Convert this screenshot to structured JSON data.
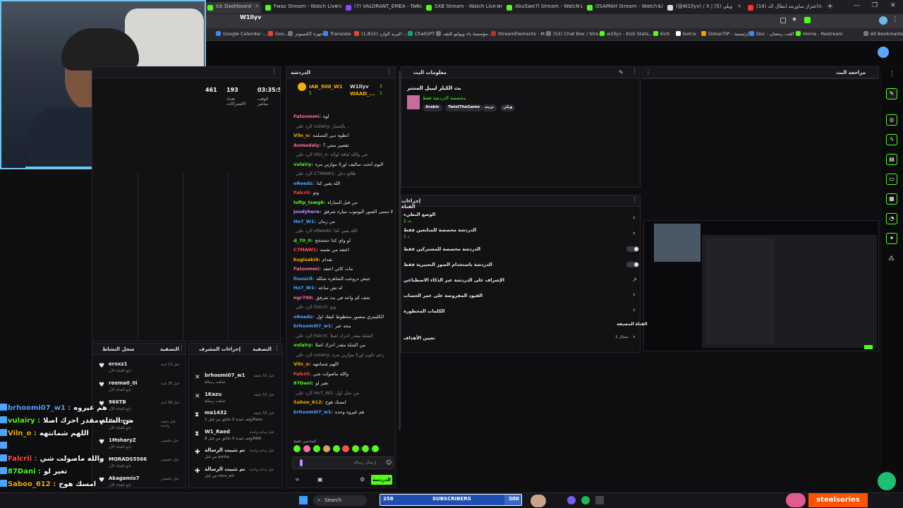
{
  "browser": {
    "tabs": [
      {
        "label": "ick Dashboard"
      },
      {
        "label": "Fwaz Stream - Watch Live on"
      },
      {
        "label": "(7) VALORANT_EMEA - Twitch"
      },
      {
        "label": "SXB Stream - Watch Live on"
      },
      {
        "label": "AbuSwe7l Stream - Watch Live"
      },
      {
        "label": "OSAMAH Stream - Watch Live"
      },
      {
        "label": "(@W1llyv) / X | (5) ويلي"
      },
      {
        "label": "(14) اعتزاز ساورمه ابطال الد..."
      }
    ],
    "bookmarks": [
      "Google Calendar -...",
      "Goo...",
      "أجهزة الكمبيوتر",
      "Translate",
      "(1,815) البريد الوارد -...",
      "ChatGPT",
      "مؤسسة باء ويوليو للتقنـ...",
      "StreamElements - M...",
      "(52) Chat Box / Stre...",
      "w1llyv - Kick Stats,...",
      "Kick",
      "botrix",
      "DokanTIP - الرئيسية",
      "Doc - العب رمضان",
      "Home - Restream",
      "All Bookmarks"
    ],
    "channel_name": "W1llyv"
  },
  "stats": {
    "time": "03:35:50",
    "time_label": "الوقت مباشر",
    "subs": "193",
    "subs_label": "تعداد الاشتراكات",
    "followers": "461"
  },
  "chat_panel": {
    "title": "الدردشة",
    "pinned": [
      {
        "user": "IAB_900_W1",
        "count": "5"
      },
      {
        "user": "W1llyv",
        "count": "3"
      },
      {
        "user": "WAAD_...",
        "count": "1"
      }
    ],
    "messages": [
      {
        "user": "Fatoommi:",
        "text": "لوه",
        "color": "#ff6b9d"
      },
      {
        "user": "",
        "text": "الرد على vulairy: يالحمار ..",
        "color": "#888"
      },
      {
        "user": "Viln_o:",
        "text": "انطوه ديي التسلمه",
        "color": "#f0b000"
      },
      {
        "user": "Anmedaly:",
        "text": "تقصير منتي ؟",
        "color": "#ff6b9d"
      },
      {
        "user": "",
        "text": "الرد على Viln_o: جي والله لياقة لولاه",
        "color": "#888"
      },
      {
        "user": "vulairy:",
        "text": "اليوم أتحت ساليف اورلا موازين مره",
        "color": "#53fc18"
      },
      {
        "user": "",
        "text": "الرد على C7MAW1: طالع دخل",
        "color": "#888"
      },
      {
        "user": "oReedz:",
        "text": "الله يعين كذا",
        "color": "#4fa3ff"
      },
      {
        "user": "Falcrii:",
        "text": "وتو",
        "color": "#ff4d4d"
      },
      {
        "user": "loftp_tswg6:",
        "text": "من قبل المباراة",
        "color": "#53fc18"
      },
      {
        "user": "joodyhere:",
        "text": "ويلي لا تنسى الصور اليوتيوب مياره شرفق",
        "color": "#c18cff"
      },
      {
        "user": "Ho7_W1:",
        "text": "من زمان",
        "color": "#4fa3ff"
      },
      {
        "user": "",
        "text": "الرد على oReedz: الله يعين كذا",
        "color": "#888"
      },
      {
        "user": "d_70_0:",
        "text": "لو واي كذا خخخخخ",
        "color": "#53fc18"
      },
      {
        "user": "C7MAW1:",
        "text": "اعتقد من نفسه",
        "color": "#ff4d4d"
      },
      {
        "user": "kugisaki4:",
        "text": "تقدام",
        "color": "#f0b000"
      },
      {
        "user": "Fatoommi:",
        "text": "مات كائي اعتقد",
        "color": "#ff6b9d"
      },
      {
        "user": "lluuucll:",
        "text": "جيش دروجب الشاهره شكله",
        "color": "#4fa3ff"
      },
      {
        "user": "Ho7_W1:",
        "text": "له نص ساعه",
        "color": "#4fa3ff"
      },
      {
        "user": "ngr700:",
        "text": "شف كم واحد في بث شرفق",
        "color": "#ff6b9d"
      },
      {
        "user": "",
        "text": "الرد على Falcrii: وتو",
        "color": "#888"
      },
      {
        "user": "oReedz:",
        "text": "الكلبيتري منصور محظوط كيفك اول",
        "color": "#4fa3ff"
      },
      {
        "user": "brhoomi07_w1:",
        "text": "محد عبر",
        "color": "#4fa3ff"
      },
      {
        "user": "",
        "text": "الرد على Falcrii: الشلة مقدر احرك اصلا",
        "color": "#888"
      },
      {
        "user": "vulairy:",
        "text": "من الشلة مقدر احرك اصلا",
        "color": "#53fc18"
      },
      {
        "user": "",
        "text": "الرد على vulairy: زعم تكون اورلا موازين مره",
        "color": "#888"
      },
      {
        "user": "Viln_o:",
        "text": "اللهم شماتتهه",
        "color": "#f0b000"
      },
      {
        "user": "Falcrii:",
        "text": "والله ماصولت شي",
        "color": "#ff4d4d"
      },
      {
        "user": "87Dani:",
        "text": "تغير لو",
        "color": "#53fc18"
      },
      {
        "user": "",
        "text": "الرد على Ho7_W1: من نحل اول",
        "color": "#888"
      },
      {
        "user": "Saboo_612:",
        "text": "امسك هوح",
        "color": "#f0b000"
      },
      {
        "user": "brhoomi07_w1:",
        "text": "هم غيروه وحده",
        "color": "#4fa3ff"
      }
    ],
    "followers_only_label": "المتابعين فقط",
    "input_placeholder": "إرسال رسالة",
    "send_button": "الدردشة"
  },
  "stream_info": {
    "title": "معلومات البث",
    "stream_title": "بث الكيلز ليبيل المنتنر",
    "category_line": "مخصصة الدردشة فقط",
    "tags": [
      "Arabic",
      "TwistTheGame",
      "تريند",
      "ويلي"
    ]
  },
  "chat_actions": {
    "title": "إجراءات القناة",
    "items": [
      {
        "label": "الوضع البطيء",
        "sub": "2 ث"
      },
      {
        "label": "الدردشة مخصصة للمتابعين فقط",
        "sub": "1 د"
      },
      {
        "label": "الدردشة مخصصة للمشتركين فقط",
        "sub": ""
      },
      {
        "label": "الدردشة باستخدام الصور التعبيرية فقط",
        "sub": ""
      },
      {
        "label": "الإشراف على الدردشة عبر الذكاء الاصطناعي",
        "sub": ""
      },
      {
        "label": "القيود المفروضة على عمر الحساب",
        "sub": ""
      },
      {
        "label": "الكلمات المحظورة",
        "sub": ""
      }
    ],
    "section_label": "القناة المضيفة",
    "host_label": "تعيين الأهداف",
    "host_value": "شمال 2"
  },
  "stream_review": {
    "title": "مراجعة البث"
  },
  "feed_panel": {
    "title": "التصفية",
    "subtitle": "سجل النشاط",
    "items": [
      {
        "name": "eroxz1",
        "sub": "تابع القناة الآن",
        "time": "قبل 13 ثانية"
      },
      {
        "name": "reema0_0i",
        "sub": "تابع القناة الآن",
        "time": "قبل 35 ثانية"
      },
      {
        "name": "966TB",
        "sub": "تابع القناة الآن",
        "time": "قبل 56 ثانية"
      },
      {
        "name": "Baderyz",
        "sub": "تابع القناة الآن",
        "time": "قبل دقيقة واحدة"
      },
      {
        "name": "1MsharyZ",
        "sub": "تابع القناة الآن",
        "time": "قبل دقيقتين"
      },
      {
        "name": "MORADS5566",
        "sub": "تابع القناة الآن",
        "time": "قبل دقيقتين"
      },
      {
        "name": "Akagamix7",
        "sub": "تابع القناة الآن",
        "time": "قبل دقيقتين"
      }
    ]
  },
  "activity_panel": {
    "title": "التصفية",
    "subtitle": "إجراءات المشرف",
    "items": [
      {
        "name": "brhoomi07_w1",
        "sub": "حذفت رسالة",
        "time": "قبل 52 دقيقة"
      },
      {
        "name": "1Kazu",
        "sub": "حذفت رسالة",
        "time": "قبل 53 دقيقة"
      },
      {
        "name": "ma1432",
        "sub": "أوقف لمدة 5 دقائق من قبل 1Kazu",
        "time": "قبل 55 دقيقة"
      },
      {
        "name": "W1_Raed",
        "sub": "أوقف لمدة 5 دقائق من قبل 8ARK",
        "time": "قبل ساعة واحدة"
      },
      {
        "name": "تم تثبيت الرسالة",
        "sub": "من قبل qmita",
        "time": "قبل ساعة واحدة"
      },
      {
        "name": "تم تثبيت الرسالة",
        "sub": "من قبل rlmx_w1",
        "time": "قبل ساعة واحدة"
      }
    ]
  },
  "overlay_chat": [
    {
      "user": "brhoomi07_w1 :",
      "text": "هم غيروه",
      "color": "#4fa3ff"
    },
    {
      "user": "vulairy :",
      "text": "من الشلة مقدر احرك اصلا",
      "color": "#53fc18"
    },
    {
      "user": "Viln_o :",
      "text": "اللهم شماتتهه",
      "color": "#f0b000"
    },
    {
      "user": "",
      "text": "",
      "color": "#fff"
    },
    {
      "user": "Falcrii :",
      "text": "والله ماصولت شي",
      "color": "#ff4d4d"
    },
    {
      "user": "87Dani :",
      "text": "تغير لو",
      "color": "#53fc18"
    },
    {
      "user": "Saboo_612 :",
      "text": "امسك هوح",
      "color": "#f0b000"
    },
    {
      "user": "brhoomi07_w1 :",
      "text": "هم غيروه وحده",
      "color": "#4fa3ff"
    }
  ],
  "taskbar": {
    "search_label": "Search",
    "sub_count": "258",
    "sub_label": "SUBSCRIBERS",
    "sub_goal": "300"
  },
  "brand": {
    "steelseries": "steelseries"
  },
  "colors": {
    "accent": "#53fc18",
    "background": "#0e0e10",
    "panel": "#121214"
  }
}
